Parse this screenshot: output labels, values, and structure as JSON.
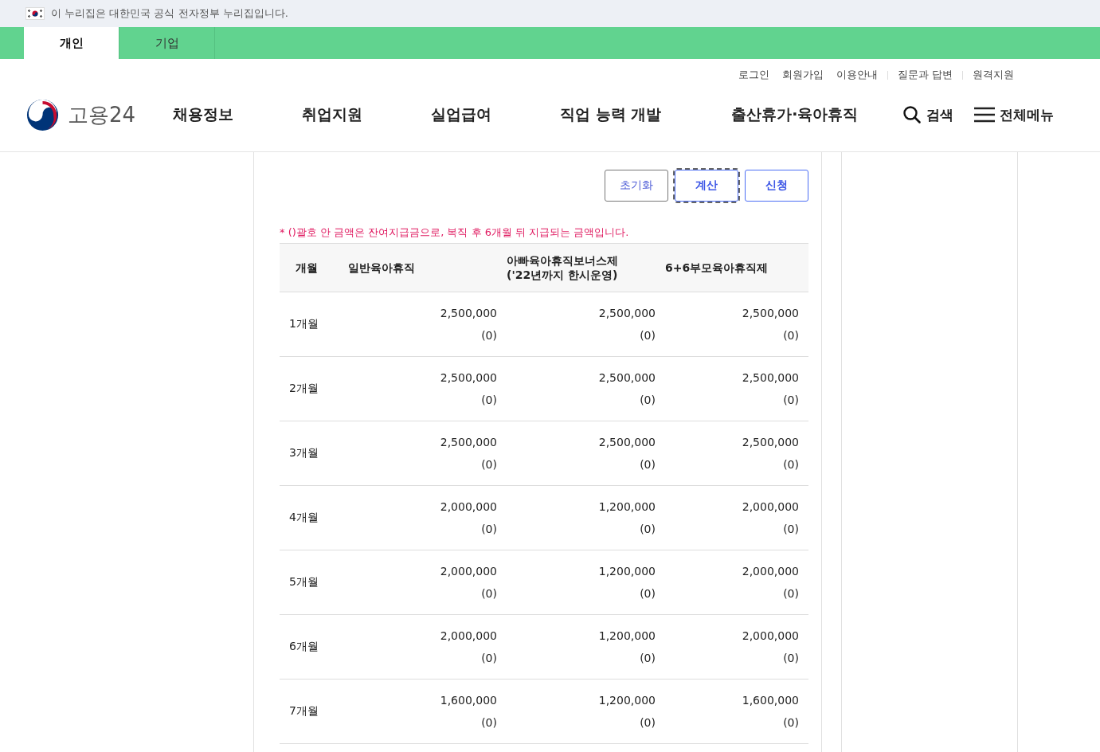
{
  "gov_banner": {
    "text": "이 누리집은 대한민국 공식 전자정부 누리집입니다."
  },
  "audience_tabs": [
    {
      "label": "개인",
      "selected": true
    },
    {
      "label": "기업",
      "selected": false
    }
  ],
  "utility_links": [
    "로그인",
    "회원가입",
    "이용안내",
    "질문과 답변",
    "원격지원"
  ],
  "logo": {
    "text": "고용24"
  },
  "main_nav": [
    "채용정보",
    "취업지원",
    "실업급여",
    "직업 능력 개발",
    "출산휴가·육아휴직"
  ],
  "search": {
    "label": "검색"
  },
  "all_menu": {
    "label": "전체메뉴"
  },
  "buttons": [
    {
      "label": "초기화",
      "kind": "plain",
      "focused": false
    },
    {
      "label": "계산",
      "kind": "primary",
      "focused": true
    },
    {
      "label": "신청",
      "kind": "primary",
      "focused": false
    }
  ],
  "notice": "* ()괄호 안 금액은 잔여지급금으로, 복직 후 6개월 뒤 지급되는 금액입니다.",
  "table": {
    "columns": [
      "개월",
      "일반육아휴직",
      "아빠육아휴직보너스제\n('22년까지 한시운영)",
      "6+6부모육아휴직제"
    ],
    "rows": [
      {
        "cells": [
          [
            "1개월"
          ],
          [
            "2,500,000",
            "(0)"
          ],
          [
            "2,500,000",
            "(0)"
          ],
          [
            "2,500,000",
            "(0)"
          ]
        ]
      },
      {
        "cells": [
          [
            "2개월"
          ],
          [
            "2,500,000",
            "(0)"
          ],
          [
            "2,500,000",
            "(0)"
          ],
          [
            "2,500,000",
            "(0)"
          ]
        ]
      },
      {
        "cells": [
          [
            "3개월"
          ],
          [
            "2,500,000",
            "(0)"
          ],
          [
            "2,500,000",
            "(0)"
          ],
          [
            "2,500,000",
            "(0)"
          ]
        ]
      },
      {
        "cells": [
          [
            "4개월"
          ],
          [
            "2,000,000",
            "(0)"
          ],
          [
            "1,200,000",
            "(0)"
          ],
          [
            "2,000,000",
            "(0)"
          ]
        ]
      },
      {
        "cells": [
          [
            "5개월"
          ],
          [
            "2,000,000",
            "(0)"
          ],
          [
            "1,200,000",
            "(0)"
          ],
          [
            "2,000,000",
            "(0)"
          ]
        ]
      },
      {
        "cells": [
          [
            "6개월"
          ],
          [
            "2,000,000",
            "(0)"
          ],
          [
            "1,200,000",
            "(0)"
          ],
          [
            "2,000,000",
            "(0)"
          ]
        ]
      },
      {
        "cells": [
          [
            "7개월"
          ],
          [
            "1,600,000",
            "(0)"
          ],
          [
            "1,200,000",
            "(0)"
          ],
          [
            "1,600,000",
            "(0)"
          ]
        ]
      }
    ]
  }
}
